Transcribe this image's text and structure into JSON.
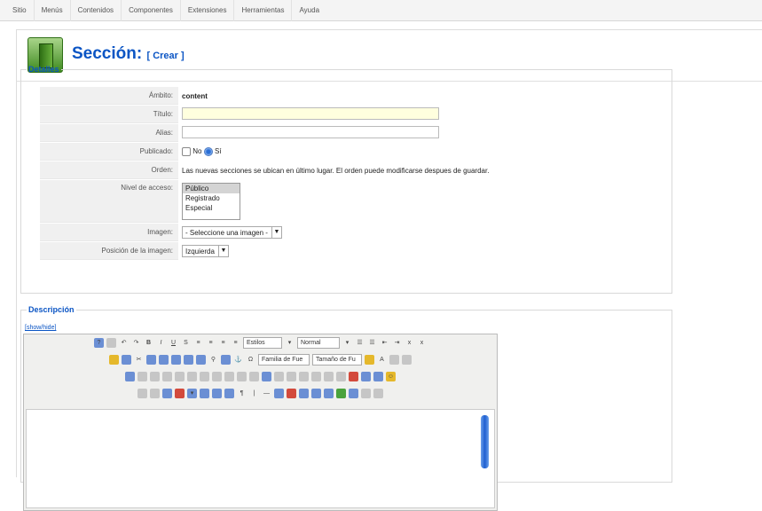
{
  "menu": [
    "Sitio",
    "Menús",
    "Contenidos",
    "Componentes",
    "Extensiones",
    "Herramientas",
    "Ayuda"
  ],
  "header": {
    "title": "Sección:",
    "action": "[ Crear ]"
  },
  "details": {
    "legend": "Detalles",
    "scope_label": "Ámbito:",
    "scope_value": "content",
    "title_label": "Título:",
    "title_value": "",
    "alias_label": "Alias:",
    "alias_value": "",
    "published_label": "Publicado:",
    "published_no": "No",
    "published_yes": "Sí",
    "order_label": "Orden:",
    "order_text": "Las nuevas secciones se ubican en último lugar. El orden puede modificarse despues de guardar.",
    "access_label": "Nivel de acceso:",
    "access_options": [
      "Público",
      "Registrado",
      "Especial"
    ],
    "image_label": "Imagen:",
    "image_value": "- Seleccione una imagen -",
    "imgpos_label": "Posición de la imagen:",
    "imgpos_value": "Izquierda"
  },
  "description": {
    "legend": "Descripción",
    "toggle": "[show/hide]",
    "styles": "Estilos",
    "format": "Normal",
    "font_family": "Familia de Fue",
    "font_size": "Tamaño de Fu"
  }
}
